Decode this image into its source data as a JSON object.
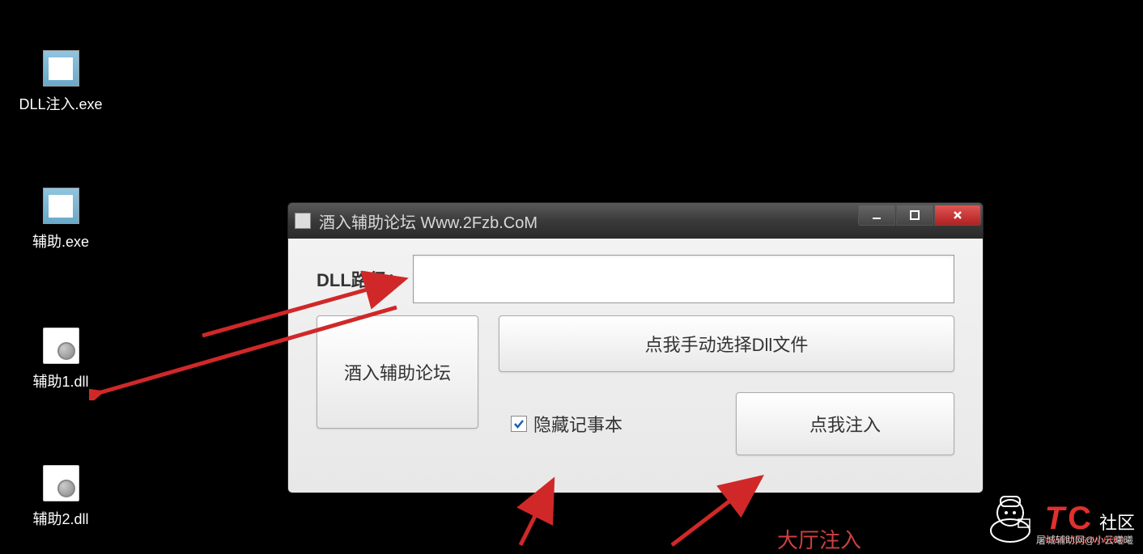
{
  "desktop": {
    "icons": [
      {
        "label": "DLL注入.exe"
      },
      {
        "label": "辅助.exe"
      },
      {
        "label": "辅助1.dll"
      },
      {
        "label": "辅助2.dll"
      }
    ]
  },
  "window": {
    "title": "酒入辅助论坛 Www.2Fzb.CoM",
    "dll_path_label": "DLL路径：",
    "dll_path_value": "",
    "forum_button": "酒入辅助论坛",
    "select_button": "点我手动选择Dll文件",
    "hide_notepad": "隐藏记事本",
    "hide_notepad_checked": true,
    "inject_button": "点我注入"
  },
  "annotations": {
    "bottom_red_text": "大厅注入"
  },
  "watermark": {
    "tc_label_t": "T",
    "tc_label_c": "C",
    "community": "社区",
    "url": "www.tcsqw.com",
    "sub": "屠城辅助网@小云曦曦"
  }
}
